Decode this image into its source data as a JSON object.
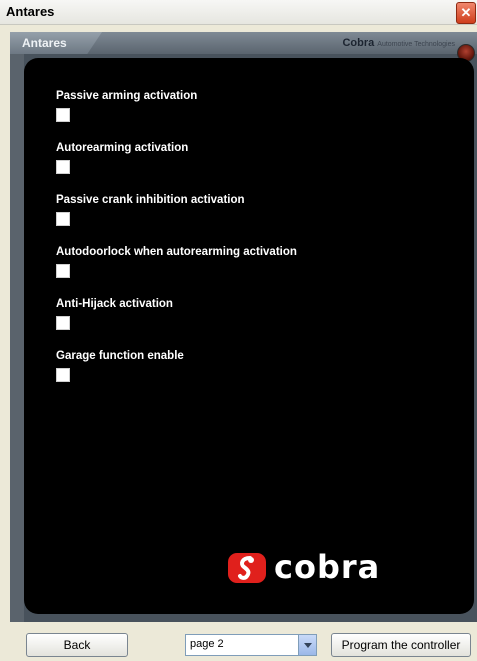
{
  "window": {
    "title": "Antares",
    "close_glyph": "✕"
  },
  "header": {
    "tab_label": "Antares",
    "brand_name": "Cobra",
    "brand_subtitle": "Automotive Technologies"
  },
  "options": [
    {
      "label": "Passive arming activation",
      "checked": false
    },
    {
      "label": "Autorearming activation",
      "checked": false
    },
    {
      "label": "Passive crank inhibition activation",
      "checked": false
    },
    {
      "label": "Autodoorlock when autorearming activation",
      "checked": false
    },
    {
      "label": "Anti-Hijack activation",
      "checked": false
    },
    {
      "label": "Garage function enable",
      "checked": false
    }
  ],
  "logo": {
    "text": "cobra"
  },
  "footer": {
    "back_label": "Back",
    "page_select_value": "page 2",
    "program_label": "Program the controller"
  },
  "colors": {
    "accent": "#e0201c",
    "panel_bg": "#000000",
    "frame": "#48525c"
  }
}
